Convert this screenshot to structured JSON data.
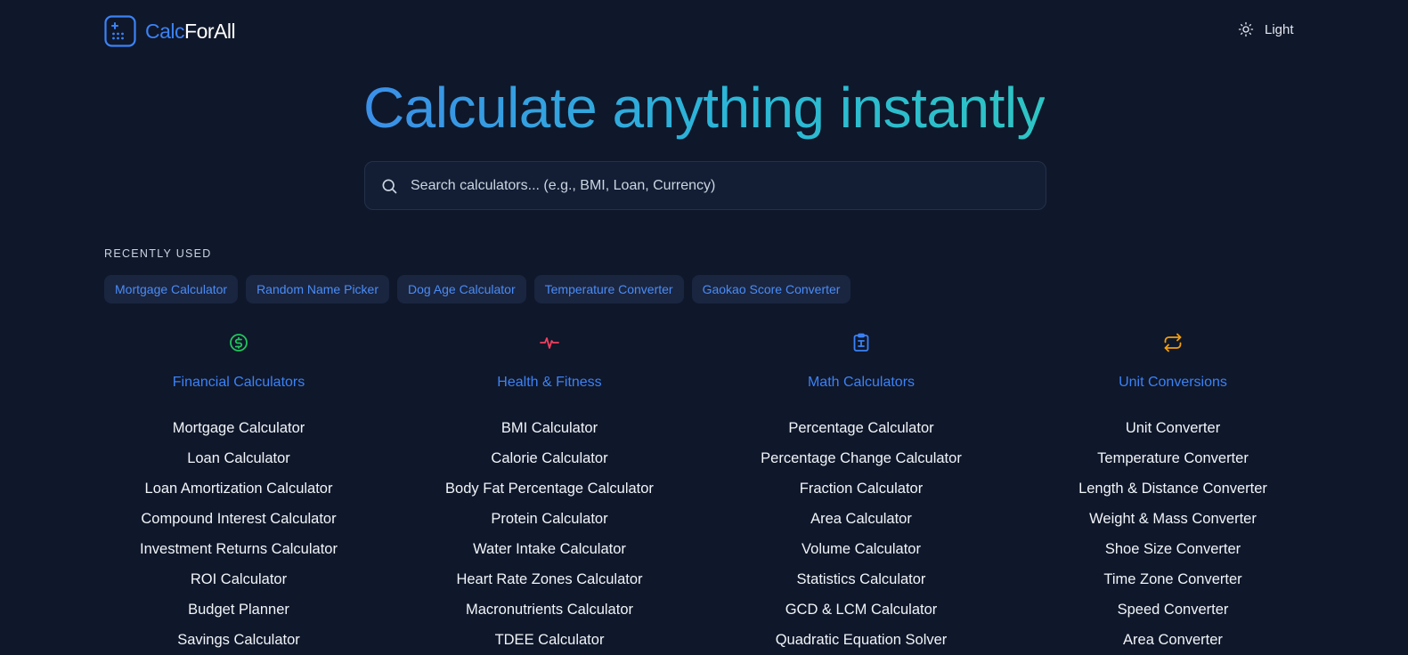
{
  "header": {
    "logo_calc": "Calc",
    "logo_forall": "ForAll",
    "theme_label": "Light"
  },
  "hero": {
    "title": "Calculate anything instantly"
  },
  "search": {
    "placeholder": "Search calculators... (e.g., BMI, Loan, Currency)"
  },
  "recent": {
    "label": "RECENTLY USED",
    "items": [
      "Mortgage Calculator",
      "Random Name Picker",
      "Dog Age Calculator",
      "Temperature Converter",
      "Gaokao Score Converter"
    ]
  },
  "categories": [
    {
      "title": "Financial Calculators",
      "icon": "dollar-circle-icon",
      "color": "#22c55e",
      "items": [
        "Mortgage Calculator",
        "Loan Calculator",
        "Loan Amortization Calculator",
        "Compound Interest Calculator",
        "Investment Returns Calculator",
        "ROI Calculator",
        "Budget Planner",
        "Savings Calculator"
      ]
    },
    {
      "title": "Health & Fitness",
      "icon": "heart-pulse-icon",
      "color": "#f43f5e",
      "items": [
        "BMI Calculator",
        "Calorie Calculator",
        "Body Fat Percentage Calculator",
        "Protein Calculator",
        "Water Intake Calculator",
        "Heart Rate Zones Calculator",
        "Macronutrients Calculator",
        "TDEE Calculator"
      ]
    },
    {
      "title": "Math Calculators",
      "icon": "clipboard-calculator-icon",
      "color": "#3b82f6",
      "items": [
        "Percentage Calculator",
        "Percentage Change Calculator",
        "Fraction Calculator",
        "Area Calculator",
        "Volume Calculator",
        "Statistics Calculator",
        "GCD & LCM Calculator",
        "Quadratic Equation Solver"
      ]
    },
    {
      "title": "Unit Conversions",
      "icon": "arrows-repeat-icon",
      "color": "#f59e0b",
      "items": [
        "Unit Converter",
        "Temperature Converter",
        "Length & Distance Converter",
        "Weight & Mass Converter",
        "Shoe Size Converter",
        "Time Zone Converter",
        "Speed Converter",
        "Area Converter"
      ]
    }
  ]
}
